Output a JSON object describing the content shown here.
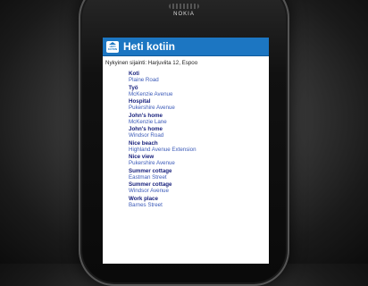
{
  "device": {
    "brand": "NOKIA"
  },
  "app": {
    "title": "Heti kotiin",
    "logo_text": "Heti kotiin"
  },
  "location": {
    "label": "Nykyinen sijainti: Harjuviita 12, Espoo"
  },
  "destinations": [
    {
      "name": "Koti",
      "street": "Plaine Road"
    },
    {
      "name": "Työ",
      "street": "McKenzie Avenue"
    },
    {
      "name": "Hospital",
      "street": "Pukershire Avenue"
    },
    {
      "name": "John's home",
      "street": "McKenzie Lane"
    },
    {
      "name": "John's home",
      "street": "Windsor Road"
    },
    {
      "name": "Nice beach",
      "street": "Highland Avenue Extension"
    },
    {
      "name": "Nice view",
      "street": "Pukershire Avenue"
    },
    {
      "name": "Summer cottage",
      "street": "Eastman Street"
    },
    {
      "name": "Summer cottage",
      "street": "Windsor Avenue"
    },
    {
      "name": "Work place",
      "street": "Barnes Street"
    }
  ],
  "colors": {
    "header": "#1c76c2",
    "name": "#1a237e",
    "street": "#3b5ab8"
  }
}
